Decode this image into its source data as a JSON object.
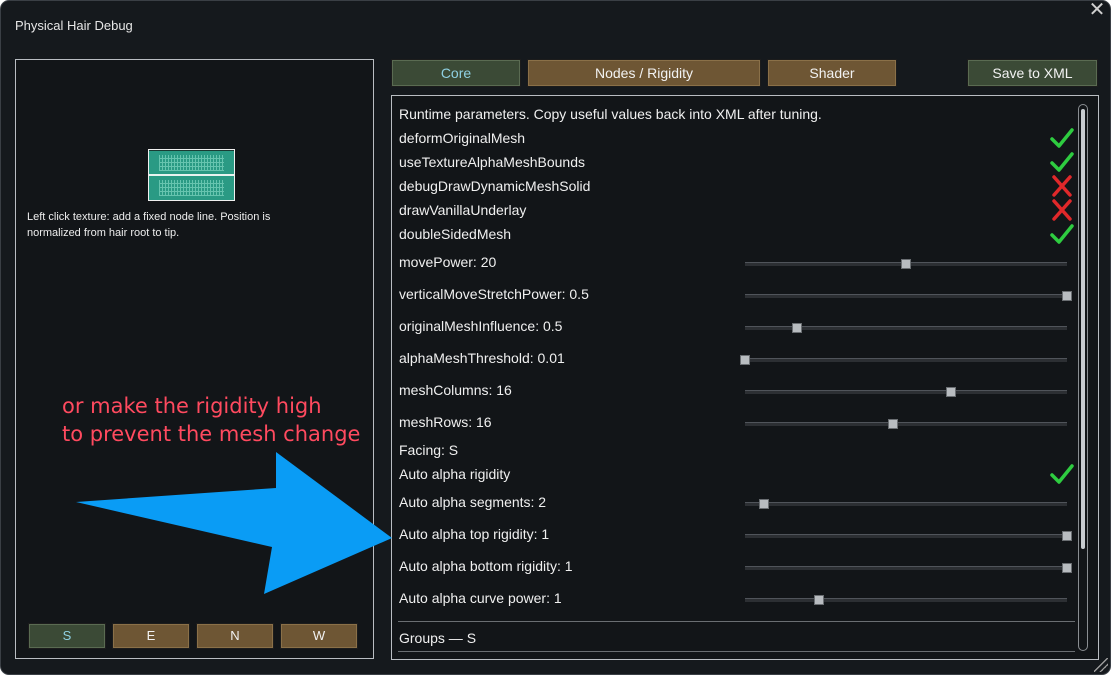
{
  "window": {
    "title": "Physical Hair Debug",
    "close": "✕"
  },
  "left_panel": {
    "help_text": "Left click texture: add a fixed node line. Position is normalized from hair root to tip.",
    "directions": [
      {
        "label": "S",
        "active": true
      },
      {
        "label": "E",
        "active": false
      },
      {
        "label": "N",
        "active": false
      },
      {
        "label": "W",
        "active": false
      }
    ]
  },
  "tabs": [
    {
      "label": "Core",
      "active": true
    },
    {
      "label": "Nodes / Rigidity",
      "active": false
    },
    {
      "label": "Shader",
      "active": false
    }
  ],
  "save_button": "Save to XML",
  "settings": {
    "intro": "Runtime parameters. Copy useful values back into XML after tuning.",
    "toggles": [
      {
        "label": "deformOriginalMesh",
        "value": true
      },
      {
        "label": "useTextureAlphaMeshBounds",
        "value": true
      },
      {
        "label": "debugDrawDynamicMeshSolid",
        "value": false
      },
      {
        "label": "drawVanillaUnderlay",
        "value": false
      },
      {
        "label": "doubleSidedMesh",
        "value": true
      }
    ],
    "sliders": [
      {
        "label": "movePower: 20",
        "fraction": 0.5
      },
      {
        "label": "verticalMoveStretchPower: 0.5",
        "fraction": 1.0
      },
      {
        "label": "originalMeshInfluence: 0.5",
        "fraction": 0.16
      },
      {
        "label": "alphaMeshThreshold: 0.01",
        "fraction": 0.0
      },
      {
        "label": "meshColumns: 16",
        "fraction": 0.64
      },
      {
        "label": "meshRows: 16",
        "fraction": 0.46
      }
    ],
    "facing": "Facing: S",
    "auto_alpha_rigidity": {
      "label": "Auto alpha rigidity",
      "value": true
    },
    "auto_sliders": [
      {
        "label": "Auto alpha segments: 2",
        "fraction": 0.06
      },
      {
        "label": "Auto alpha top rigidity: 1",
        "fraction": 1.0
      },
      {
        "label": "Auto alpha bottom rigidity: 1",
        "fraction": 1.0
      },
      {
        "label": "Auto alpha curve power: 1",
        "fraction": 0.23
      }
    ],
    "groups_header": "Groups — S"
  },
  "annotation": {
    "line1": "or make the rigidity high",
    "line2": "to prevent the mesh change",
    "color": "#ff4a5f",
    "arrow_color": "#0a9cf5"
  },
  "colors": {
    "check": "#2ecc40",
    "cross": "#e0282a",
    "active_button": "#3b4a36",
    "normal_button": "#6e5634"
  }
}
